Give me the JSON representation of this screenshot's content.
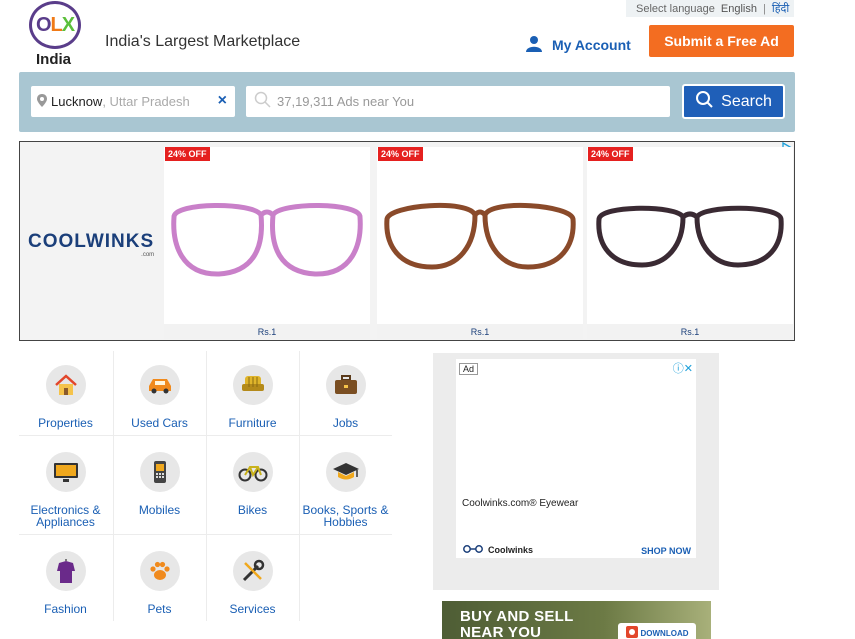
{
  "language_bar": {
    "prompt": "Select language",
    "english": "English",
    "separator": "|",
    "hindi": "हिंदी"
  },
  "logo": {
    "o": "O",
    "l": "L",
    "x": "X",
    "country": "India"
  },
  "tagline": "India's Largest Marketplace",
  "account": {
    "label": "My Account"
  },
  "submit_ad": {
    "label": "Submit a Free Ad"
  },
  "search": {
    "location_city": "Lucknow",
    "location_state": ", Uttar Pradesh",
    "clear": "×",
    "query_placeholder": "37,19,311 Ads near You",
    "button": "Search"
  },
  "banner_ad": {
    "brand": "COOLWINKS",
    "brand_suffix": ".com",
    "products": [
      {
        "badge": "24% OFF",
        "price": "Rs.1",
        "frame_color": "#c980c9"
      },
      {
        "badge": "24% OFF",
        "price": "Rs.1",
        "frame_color": "#8a4a2a"
      },
      {
        "badge": "24% OFF",
        "price": "Rs.1",
        "frame_color": "#3a2a33"
      }
    ]
  },
  "categories": [
    {
      "label": "Properties",
      "icon": "house-icon"
    },
    {
      "label": "Used Cars",
      "icon": "car-icon"
    },
    {
      "label": "Furniture",
      "icon": "sofa-icon"
    },
    {
      "label": "Jobs",
      "icon": "briefcase-icon"
    },
    {
      "label": "Electronics & Appliances",
      "icon": "tv-icon"
    },
    {
      "label": "Mobiles",
      "icon": "mobile-icon"
    },
    {
      "label": "Bikes",
      "icon": "bicycle-icon"
    },
    {
      "label": "Books, Sports & Hobbies",
      "icon": "graduation-cap-icon"
    },
    {
      "label": "Fashion",
      "icon": "shirt-icon"
    },
    {
      "label": "Pets",
      "icon": "paw-icon"
    },
    {
      "label": "Services",
      "icon": "tools-icon"
    }
  ],
  "side_ad": {
    "label": "Ad",
    "title": "Coolwinks.com® Eyewear",
    "brand": "Coolwinks",
    "cta": "SHOP NOW"
  },
  "bottom_banner": {
    "line1": "BUY AND SELL",
    "line2": "NEAR YOU",
    "button": "DOWNLOAD"
  },
  "colors": {
    "accent_orange": "#f36d21",
    "link_blue": "#1a5fb4",
    "search_blue": "#1f5fb8",
    "search_bg": "#a9c6d2"
  }
}
